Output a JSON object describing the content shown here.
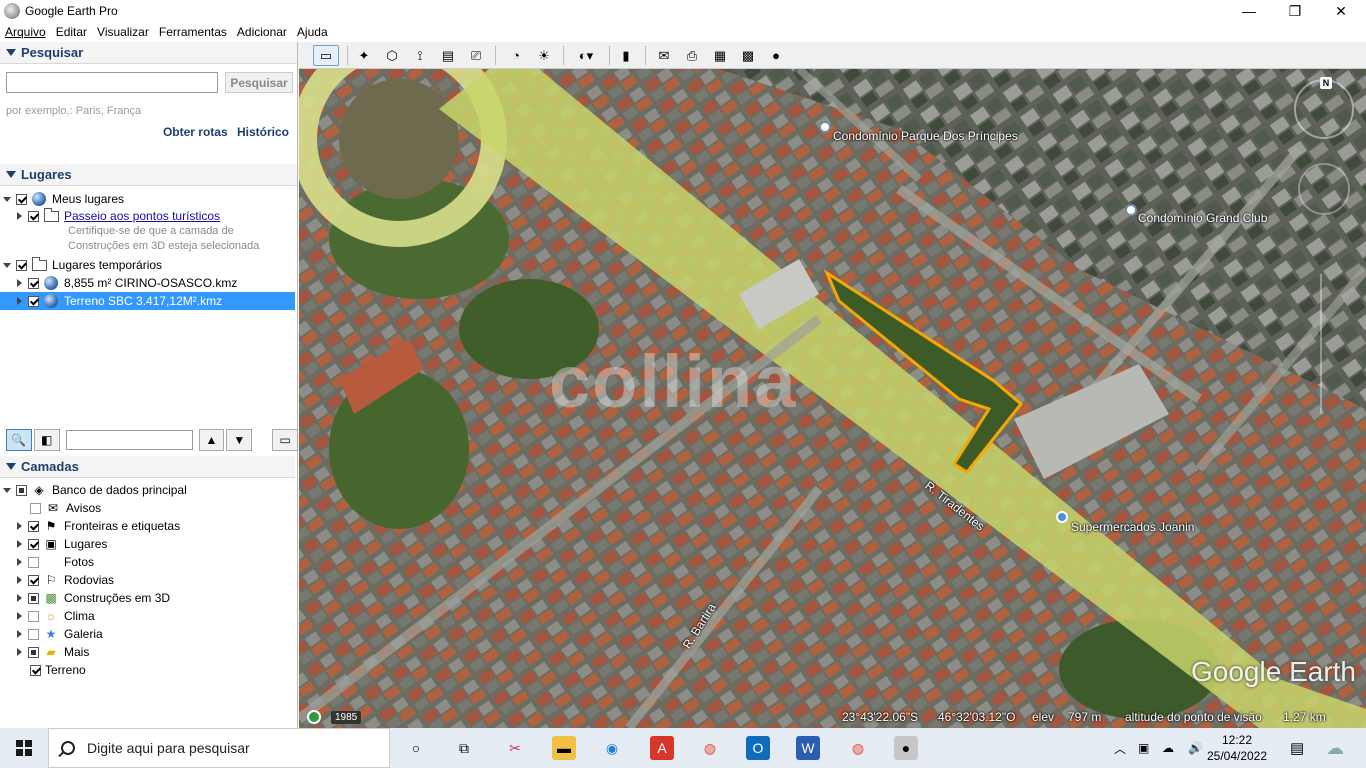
{
  "window": {
    "title": "Google Earth Pro",
    "minimize_glyph": "—",
    "maximize_glyph": "❐",
    "close_glyph": "✕"
  },
  "menu": [
    "Arquivo",
    "Editar",
    "Visualizar",
    "Ferramentas",
    "Adicionar",
    "Ajuda"
  ],
  "search": {
    "header": "Pesquisar",
    "value": "",
    "button": "Pesquisar",
    "hint": "por exemplo,: Paris, França",
    "routes_link": "Obter rotas",
    "history_link": "Histórico"
  },
  "places": {
    "header": "Lugares",
    "my_places": "Meus lugares",
    "tour": "Passeio aos pontos turísticos",
    "tour_note_1": "Certifique-se de que a camada de",
    "tour_note_2": "Construções em 3D esteja selecionada",
    "temporary": "Lugares temporários",
    "file_1": "8,855 m² CIRINO-OSASCO.kmz",
    "file_2": "Terreno SBC 3.417,12M².kmz"
  },
  "layers": {
    "header": "Camadas",
    "primary_db": "Banco de dados principal",
    "items": [
      "Avisos",
      "Fronteiras e etiquetas",
      "Lugares",
      "Fotos",
      "Rodovias",
      "Construções em 3D",
      "Clima",
      "Galeria",
      "Mais"
    ],
    "terrain": "Terreno"
  },
  "map": {
    "labels": {
      "condo_1": "Condomínio Parque Dos Príncipes",
      "condo_2": "Condomínio Grand Club",
      "market": "Supermercados Joanin",
      "street_1": "R. Tiradentes",
      "street_2": "R. Bartira"
    },
    "watermark": "collina",
    "logo": "Google Earth",
    "year": "1985",
    "compass_n": "N",
    "status": {
      "lat": "23°43'22.06\"S",
      "lon": "46°32'03.12\"O",
      "elev_label": "elev",
      "elev_value": "797 m",
      "eye_label": "altitude do ponto de visão",
      "eye_value": "1.27 km"
    }
  },
  "taskbar": {
    "search_placeholder": "Digite aqui para pesquisar",
    "time": "12:22",
    "date": "25/04/2022"
  }
}
